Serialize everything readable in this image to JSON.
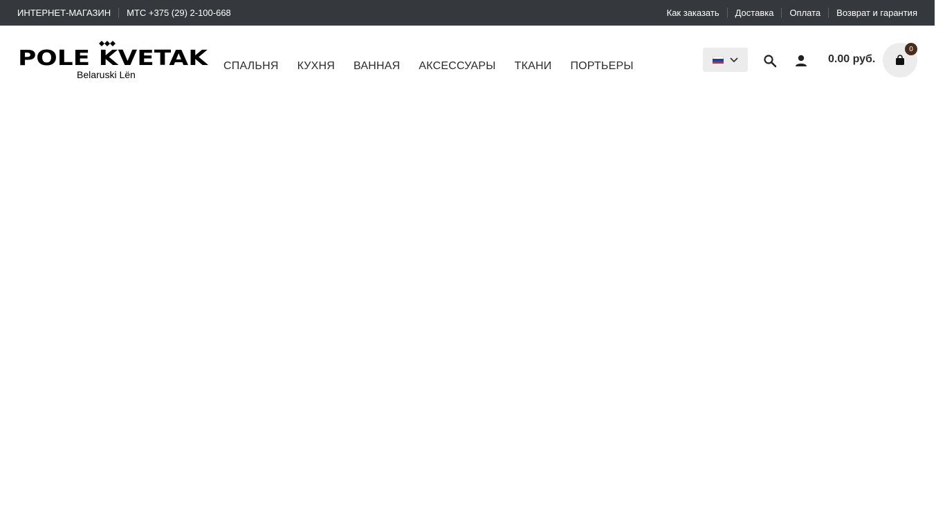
{
  "topbar": {
    "shop_label": "ИНТЕРНЕТ-МАГАЗИН",
    "phone": "МТС +375 (29) 2-100-668",
    "links": [
      "Как заказать",
      "Доставка",
      "Оплата",
      "Возврат и гарантия"
    ]
  },
  "logo": {
    "brand": "POLE KVETAK",
    "tagline": "Belaruski Lën"
  },
  "nav": {
    "items": [
      "СПАЛЬНЯ",
      "КУХНЯ",
      "ВАННАЯ",
      "АКСЕССУАРЫ",
      "ТКАНИ",
      "ПОРТЬЕРЫ"
    ]
  },
  "language": {
    "selected": "ru",
    "icon": "russian-flag-icon"
  },
  "cart": {
    "total": "0.00 руб.",
    "count": "0",
    "icon": "shopping-bag-icon"
  },
  "colors": {
    "topbar_bg": "#35383d",
    "badge_bg": "#4a2c1a",
    "button_bg": "#ececec"
  }
}
